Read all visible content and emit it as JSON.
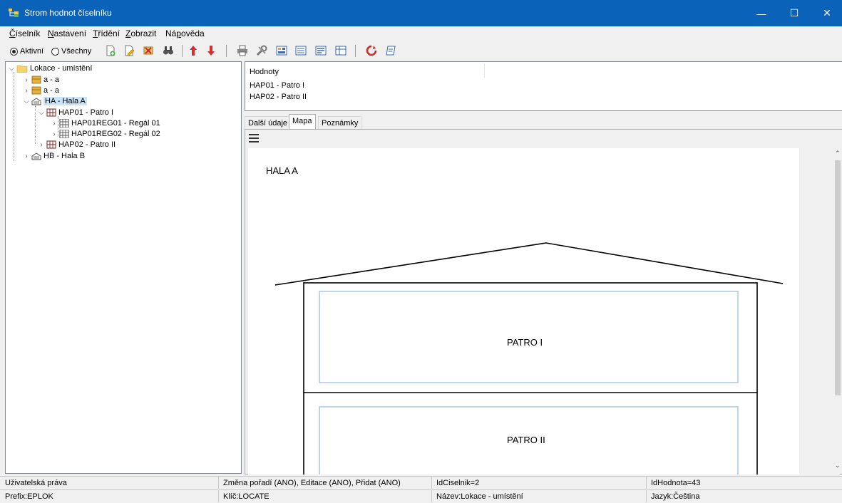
{
  "window": {
    "title": "Strom hodnot číselníku",
    "minimize": "—",
    "maximize": "☐",
    "close": "✕"
  },
  "menu": [
    {
      "pre": "",
      "u": "Č",
      "post": "íselník"
    },
    {
      "pre": "",
      "u": "N",
      "post": "astavení"
    },
    {
      "pre": "",
      "u": "T",
      "post": "řídění"
    },
    {
      "pre": "",
      "u": "Z",
      "post": "obrazit"
    },
    {
      "pre": "Ná",
      "u": "p",
      "post": "ověda"
    }
  ],
  "filter": {
    "active_label": "Aktivní",
    "all_label": "Všechny",
    "selected": "active"
  },
  "toolbar_icons": [
    "new-icon",
    "edit-icon",
    "delete-icon",
    "find-icon",
    "move-up-icon",
    "move-down-icon",
    "print-icon",
    "settings-icon",
    "view1-icon",
    "view2-icon",
    "view3-icon",
    "view4-icon",
    "refresh-icon",
    "note-icon"
  ],
  "tree": {
    "root": "Lokace - umístění",
    "items": [
      {
        "label": "a - a",
        "icon": "box-icon"
      },
      {
        "label": "a - a",
        "icon": "box-icon"
      },
      {
        "label": "HA - Hala A",
        "icon": "hall-icon",
        "selected": true
      },
      {
        "label": "HAP01 - Patro I",
        "icon": "floor-icon"
      },
      {
        "label": "HAP01REG01 - Regál 01",
        "icon": "shelf-icon"
      },
      {
        "label": "HAP01REG02 - Regál 02",
        "icon": "shelf-icon"
      },
      {
        "label": "HAP02 - Patro II",
        "icon": "floor-icon"
      },
      {
        "label": "HB - Hala B",
        "icon": "hall-icon"
      }
    ]
  },
  "values": {
    "header": "Hodnoty",
    "rows": [
      "HAP01 - Patro I",
      "HAP02 - Patro II"
    ]
  },
  "tabs": [
    {
      "label": "Další údaje",
      "active": false
    },
    {
      "label": "Mapa",
      "active": true
    },
    {
      "label": "Poznámky",
      "active": false
    }
  ],
  "map": {
    "title": "HALA A",
    "floors": [
      "PATRO I",
      "PATRO II"
    ],
    "floor_border_color": "#a9c7e8"
  },
  "status": {
    "row1": [
      "Uživatelská práva",
      "Změna pořadí (ANO), Editace (ANO), Přidat (ANO)",
      "IdCiselnik=2",
      "IdHodnota=43"
    ],
    "row2": [
      "Prefix:EPLOK",
      "Klíč:LOCATE",
      "Název:Lokace - umístění",
      "Jazyk:Čeština"
    ]
  },
  "colors": {
    "titlebar": "#0a63b8",
    "selection": "#cce4f7"
  }
}
